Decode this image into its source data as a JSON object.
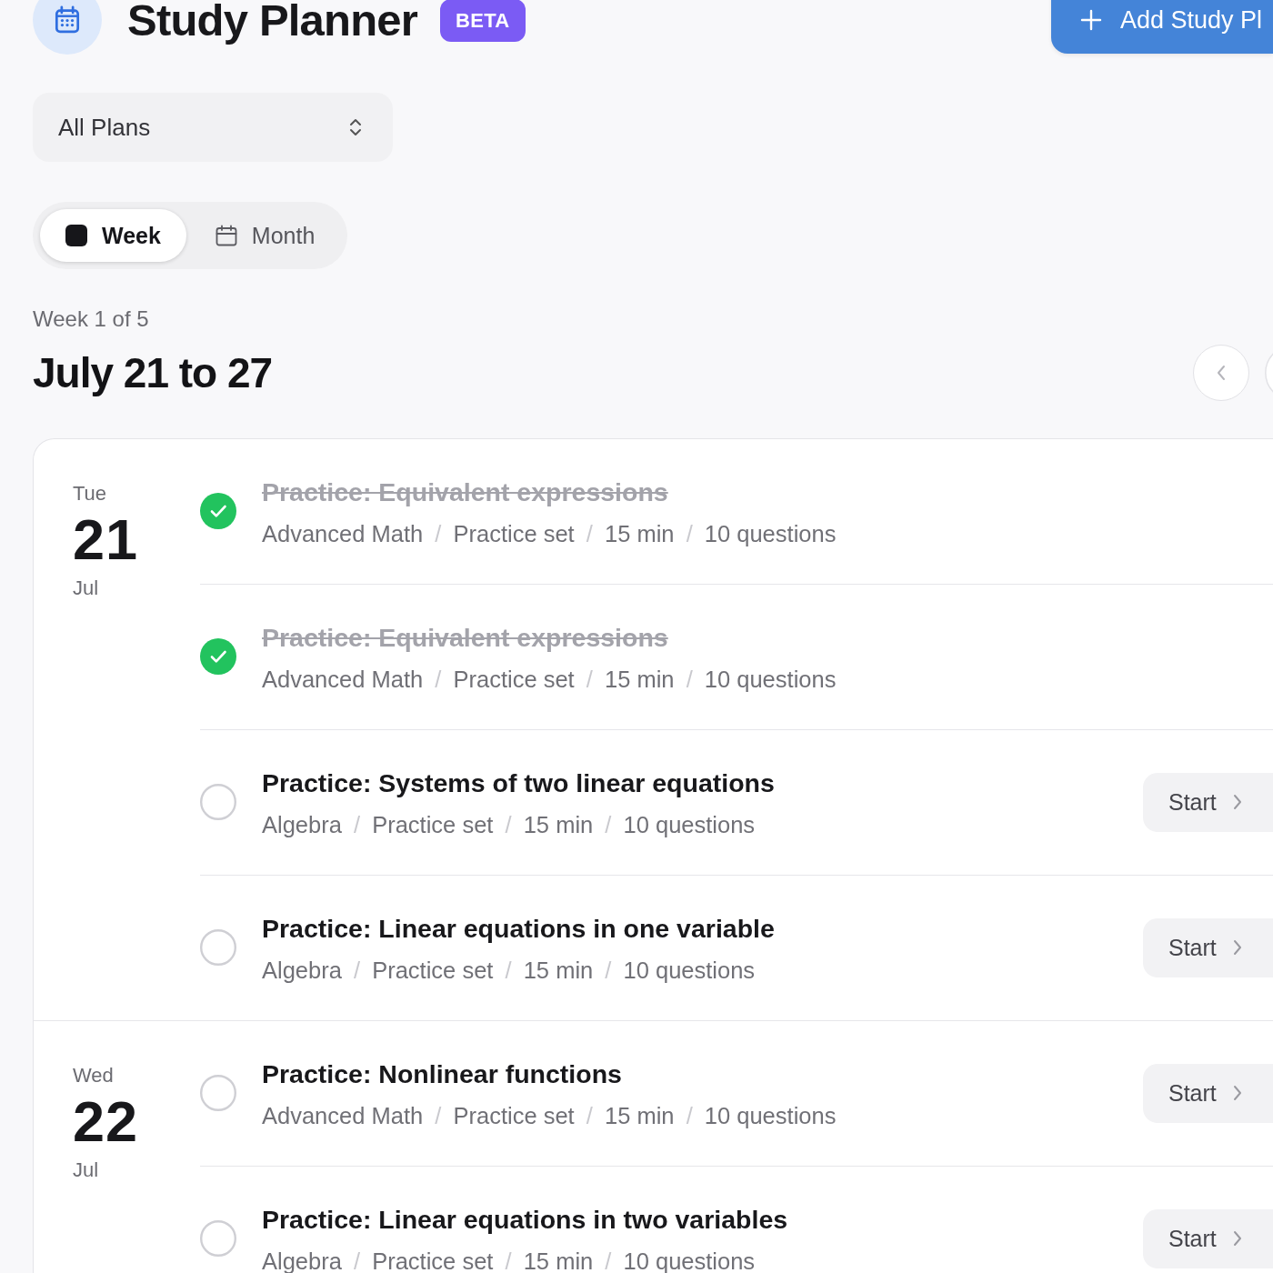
{
  "header": {
    "title": "Study Planner",
    "badge": "BETA",
    "add_button": "Add Study Pl"
  },
  "plan_select": {
    "value": "All Plans"
  },
  "view_tabs": [
    {
      "label": "Week",
      "selected": true
    },
    {
      "label": "Month",
      "selected": false
    }
  ],
  "week": {
    "caption": "Week 1 of 5",
    "title": "July 21 to 27"
  },
  "days": [
    {
      "weekday": "Tue",
      "day": "21",
      "month": "Jul",
      "tasks": [
        {
          "title": "Practice: Equivalent expressions",
          "done": true,
          "meta": [
            "Advanced Math",
            "/",
            "Practice set",
            "/",
            "15 min",
            "/",
            "10 questions"
          ]
        },
        {
          "title": "Practice: Equivalent expressions",
          "done": true,
          "meta": [
            "Advanced Math",
            "/",
            "Practice set",
            "/",
            "15 min",
            "/",
            "10 questions"
          ]
        },
        {
          "title": "Practice: Systems of two linear equations",
          "done": false,
          "meta": [
            "Algebra",
            "/",
            "Practice set",
            "/",
            "15 min",
            "/",
            "10 questions"
          ],
          "action": "Start"
        },
        {
          "title": "Practice: Linear equations in one variable",
          "done": false,
          "meta": [
            "Algebra",
            "/",
            "Practice set",
            "/",
            "15 min",
            "/",
            "10 questions"
          ],
          "action": "Start"
        }
      ]
    },
    {
      "weekday": "Wed",
      "day": "22",
      "month": "Jul",
      "tasks": [
        {
          "title": "Practice: Nonlinear functions",
          "done": false,
          "meta": [
            "Advanced Math",
            "/",
            "Practice set",
            "/",
            "15 min",
            "/",
            "10 questions"
          ],
          "action": "Start"
        },
        {
          "title": "Practice: Linear equations in two variables",
          "done": false,
          "meta": [
            "Algebra",
            "/",
            "Practice set",
            "/",
            "15 min",
            "/",
            "10 questions"
          ],
          "action": "Start"
        }
      ]
    }
  ]
}
